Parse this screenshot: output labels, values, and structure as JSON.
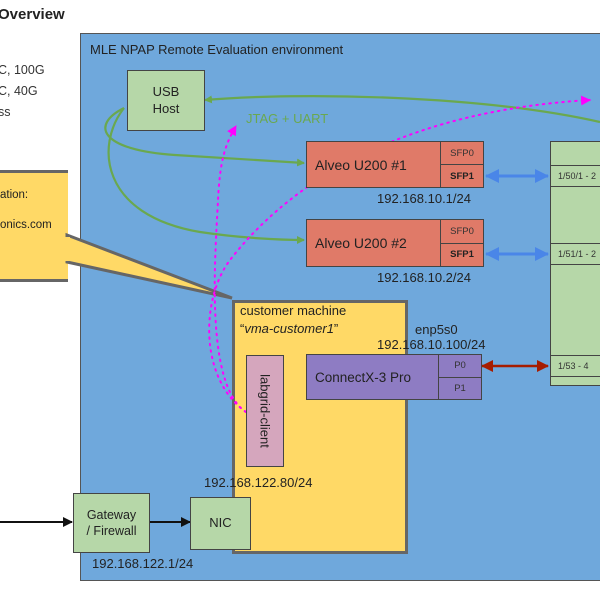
{
  "header": {
    "title": "Overview",
    "side_lines": [
      "C, 100G",
      "C, 40G",
      "ss"
    ]
  },
  "environment": {
    "title": "MLE NPAP Remote Evaluation environment"
  },
  "callout": {
    "lines": [
      "ation:",
      "onics.com"
    ]
  },
  "usb_host": {
    "line1": "USB",
    "line2": "Host"
  },
  "jtag_label": "JTAG + UART",
  "alveo_cards": [
    {
      "name": "Alveo U200 #1",
      "ports": [
        "SFP0",
        "SFP1"
      ],
      "ip": "192.168.10.1/24"
    },
    {
      "name": "Alveo U200 #2",
      "ports": [
        "SFP0",
        "SFP1"
      ],
      "ip": "192.168.10.2/24"
    }
  ],
  "customer_machine": {
    "title": "customer machine",
    "hostname_open": "“",
    "hostname": "vma-customer1",
    "hostname_close": "”",
    "labgrid": "labgrid-client",
    "ip": "192.168.122.80/24"
  },
  "nic_connectx": {
    "iface": "enp5s0",
    "ip": "192.168.10.100/24",
    "name": "ConnectX-3 Pro",
    "ports": [
      "P0",
      "P1"
    ]
  },
  "switch": {
    "ports": [
      "1/50/1 - 2",
      "1/51/1 - 2",
      "1/53 - 4"
    ]
  },
  "gateway": {
    "line1": "Gateway",
    "line2": "/ Firewall",
    "ip": "192.168.122.1/24"
  },
  "nic": {
    "label": "NIC"
  },
  "colors": {
    "environment_bg": "#6fa8dc",
    "green_box": "#b6d7a8",
    "alveo": "#e07a68",
    "customer": "#ffd966",
    "labgrid": "#d5a6bd",
    "connectx": "#8e7cc3",
    "jtag_line": "#6aa84f",
    "dotted": "#ff00ff",
    "sfp_arrow": "#4a86e8",
    "p0_arrow": "#a61c00"
  }
}
